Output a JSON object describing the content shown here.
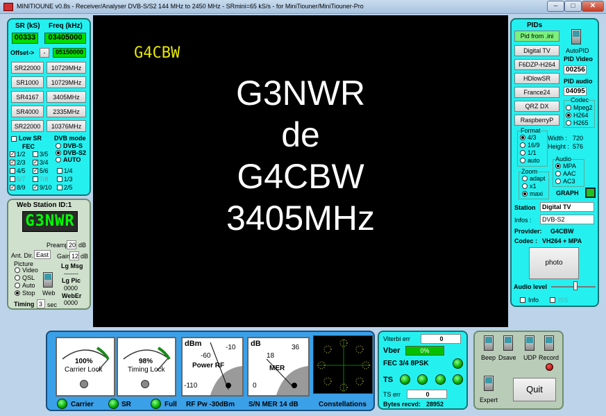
{
  "window": {
    "title": "MINITIOUNE v0.8s - Receiver/Analyser DVB-S/S2 144 MHz to 2450 MHz - SRmini=65 kS/s - for MiniTiouner/MiniTiouner-Pro",
    "min": "–",
    "max": "□",
    "close": "✕"
  },
  "tuner": {
    "sr_label": "SR (kS)",
    "freq_label": "Freq (kHz)",
    "sr_value": "00333",
    "freq_value": "03405000",
    "offset_label": "Offset->",
    "offset_sign": "-",
    "offset_value": "05150000",
    "presets": [
      {
        "sr": "SR22000",
        "freq": "10729MHz"
      },
      {
        "sr": "SR1000",
        "freq": "10729MHz"
      },
      {
        "sr": "SR4167",
        "freq": "3405MHz"
      },
      {
        "sr": "SR4000",
        "freq": "2335MHz"
      },
      {
        "sr": "SR22000",
        "freq": "10376MHz"
      }
    ],
    "low_sr": "Low SR",
    "fec_label": "FEC",
    "dvb_mode_label": "DVB mode",
    "dvb_modes": [
      "DVB-S",
      "DVB-S2",
      "AUTO"
    ],
    "fec": [
      "1/2",
      "3/5",
      "2/3",
      "3/4",
      "4/5",
      "5/6",
      "1/4",
      "5/7",
      "7/8",
      "1/3",
      "8/9",
      "9/10",
      "2/5"
    ]
  },
  "webstation": {
    "title": "Web Station ID:1",
    "callsign": "G3NWR",
    "preamp_label": "Preamp",
    "preamp_value": "20",
    "preamp_unit": "dB",
    "antdir_label": "Ant. Dir.",
    "antdir_value": "East",
    "gain_label": "Gain",
    "gain_value": "12",
    "gain_unit": "dB",
    "picture_label": "Picture",
    "picture_opts": [
      "Video",
      "QSL",
      "Auto",
      "Stop"
    ],
    "lg_msg": "Lg Msg",
    "lg_msg_val": "-------",
    "lg_pic": "Lg Pic",
    "lg_pic_val": "0000",
    "weber": "WebEr",
    "weber_val": "0000",
    "web": "Web",
    "timing_label": "Timing",
    "timing_value": "3",
    "timing_unit": "sec"
  },
  "video": {
    "overlay": "G4CBW",
    "lines": [
      "G3NWR",
      "de",
      "G4CBW",
      "3405MHz"
    ]
  },
  "pids": {
    "title": "PIDs",
    "buttons": [
      "Pid from .ini",
      "Digital TV",
      "F6DZP-H264",
      "HDlowSR",
      "France24",
      "QRZ DX",
      "RaspberryP"
    ],
    "autopid": "AutoPID",
    "pid_video_label": "PID Video",
    "pid_video": "00256",
    "pid_audio_label": "PID audio",
    "pid_audio": "04095",
    "codec_label": "Codec",
    "codecs": [
      "Mpeg2",
      "H264",
      "H265"
    ],
    "format_label": "Format",
    "formats": [
      "4/3",
      "16/9",
      "1/1",
      "auto"
    ],
    "width_label": "Width :",
    "width": "720",
    "height_label": "Height :",
    "height": "576",
    "zoom_label": "Zoom",
    "zooms": [
      "adapt",
      "x1",
      "maxi"
    ],
    "audio_label": "Audio",
    "audios": [
      "MPA",
      "AAC",
      "AC3"
    ],
    "graph": "GRAPH",
    "station_label": "Station",
    "station_value": "Digital TV",
    "infos_label": "Infos :",
    "infos_value": "DVB-S2",
    "provider_label": "Provider:",
    "provider_value": "G4CBW",
    "codec_out_label": "Codec :",
    "codec_out_value": "VH264 + MPA",
    "photo": "photo",
    "audio_level": "Audio level",
    "info_cb": "Info",
    "iss_cb": "ISS"
  },
  "meters": {
    "carrier_pct": "100%",
    "carrier_label": "Carrier Lock",
    "timing_pct": "98%",
    "timing_label": "Timing Lock",
    "power_unit": "dBm",
    "power_ticks": [
      "-60",
      "-10",
      "-110"
    ],
    "power_label": "Power RF",
    "mer_unit": "dB",
    "mer_ticks": [
      "18",
      "36",
      "0"
    ],
    "mer_label": "MER",
    "carrier_led": "Carrier",
    "sr_led": "SR",
    "full_led": "Full",
    "rf_pw": "RF Pw -30dBm",
    "sn_mer": "S/N MER  14 dB",
    "constellations": "Constellations"
  },
  "status": {
    "viterbi_label": "Viterbi err",
    "viterbi_value": "0",
    "vber_label": "Vber",
    "vber_value": "0%",
    "fec_label": "FEC 3/4 8PSK",
    "ts_label": "TS",
    "ts_err_label": "TS err",
    "ts_err_value": "0",
    "bytes_label": "Bytes recvd:",
    "bytes_value": "28952"
  },
  "controls": {
    "beep": "Beep",
    "dsave": "Dsave",
    "udp": "UDP",
    "record": "Record",
    "expert": "Expert",
    "quit": "Quit"
  },
  "colors": {
    "panel": "#25f0f0",
    "video_text": "#ffffff",
    "overlay": "#e6e600",
    "led": "#00bb00"
  }
}
